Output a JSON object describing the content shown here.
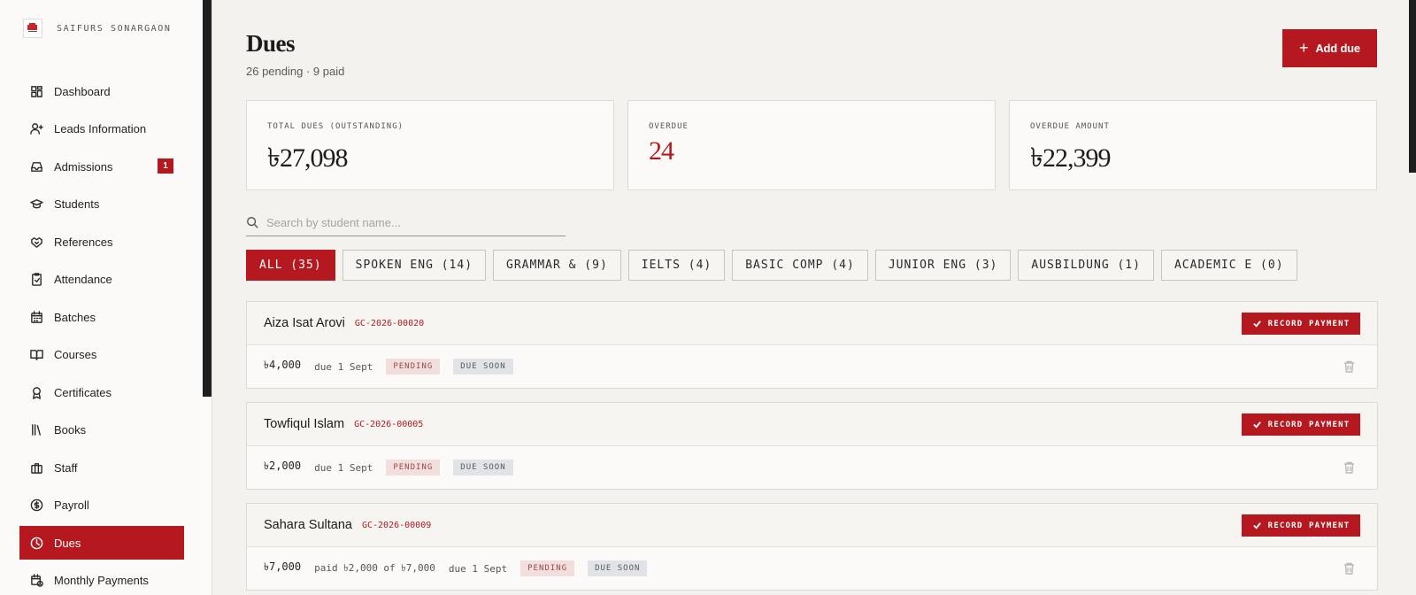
{
  "brand": {
    "name": "SAIFURS SONARGAON"
  },
  "sidebar": {
    "items": [
      {
        "label": "Dashboard",
        "icon": "dashboard-icon"
      },
      {
        "label": "Leads Information",
        "icon": "user-plus-icon"
      },
      {
        "label": "Admissions",
        "icon": "inbox-icon",
        "badge": "1"
      },
      {
        "label": "Students",
        "icon": "graduation-cap-icon"
      },
      {
        "label": "References",
        "icon": "handshake-icon"
      },
      {
        "label": "Attendance",
        "icon": "clipboard-check-icon"
      },
      {
        "label": "Batches",
        "icon": "calendar-icon"
      },
      {
        "label": "Courses",
        "icon": "book-open-icon"
      },
      {
        "label": "Certificates",
        "icon": "award-icon"
      },
      {
        "label": "Books",
        "icon": "library-icon"
      },
      {
        "label": "Staff",
        "icon": "briefcase-icon"
      },
      {
        "label": "Payroll",
        "icon": "dollar-circle-icon"
      },
      {
        "label": "Dues",
        "icon": "clock-icon",
        "active": true
      },
      {
        "label": "Monthly Payments",
        "icon": "calendar-clock-icon"
      }
    ]
  },
  "header": {
    "title": "Dues",
    "subtitle": "26 pending · 9 paid",
    "add_label": "Add due"
  },
  "stats": [
    {
      "label": "TOTAL DUES (OUTSTANDING)",
      "value": "৳27,098"
    },
    {
      "label": "OVERDUE",
      "value": "24"
    },
    {
      "label": "OVERDUE AMOUNT",
      "value": "৳22,399"
    }
  ],
  "search": {
    "placeholder": "Search by student name..."
  },
  "filters": [
    {
      "label": "ALL (35)",
      "active": true
    },
    {
      "label": "SPOKEN ENG (14)"
    },
    {
      "label": "GRAMMAR & (9)"
    },
    {
      "label": "IELTS (4)"
    },
    {
      "label": "BASIC COMP (4)"
    },
    {
      "label": "JUNIOR ENG (3)"
    },
    {
      "label": "AUSBILDUNG (1)"
    },
    {
      "label": "ACADEMIC E (0)"
    }
  ],
  "dues": [
    {
      "name": "Aiza Isat Arovi",
      "id": "GC-2026-00020",
      "amount": "৳4,000",
      "paid": "",
      "due": "due 1 Sept",
      "status": "PENDING",
      "flag": "DUE SOON"
    },
    {
      "name": "Towfiqul Islam",
      "id": "GC-2026-00005",
      "amount": "৳2,000",
      "paid": "",
      "due": "due 1 Sept",
      "status": "PENDING",
      "flag": "DUE SOON"
    },
    {
      "name": "Sahara Sultana",
      "id": "GC-2026-00009",
      "amount": "৳7,000",
      "paid": "paid ৳2,000 of ৳7,000",
      "due": "due 1 Sept",
      "status": "PENDING",
      "flag": "DUE SOON"
    }
  ],
  "record_payment_label": "RECORD PAYMENT",
  "colors": {
    "accent": "#b5191f",
    "background": "#f4f2ee"
  }
}
